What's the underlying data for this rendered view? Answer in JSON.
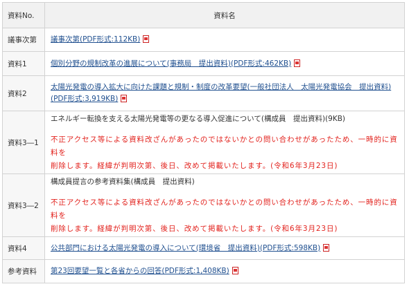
{
  "headers": {
    "no": "資料No.",
    "name": "資料名"
  },
  "rows": [
    {
      "no": "議事次第",
      "link": "議事次第(PDF形式:112KB)"
    },
    {
      "no": "資料1",
      "link": "個別分野の規制改革の進展について(事務局　提出資料)(PDF形式:462KB)"
    },
    {
      "no": "資料2",
      "link": "太陽光発電の導入拡大に向けた課題と規制・制度の改革要望(一般社団法人　太陽光発電協会　提出資料)(PDF形式:3,919KB)"
    },
    {
      "no": "資料3―1",
      "text": "エネルギー転換を支える太陽光発電等の更なる導入促進について(構成員　提出資料)(9KB)",
      "notice_1": "不正アクセス等による資料改ざんがあったのではないかとの問い合わせがあったため、一時的に資料を",
      "notice_2": "削除します。経緯が判明次第、後日、改めて掲載いたします。(令和6年3月23日)"
    },
    {
      "no": "資料3―2",
      "text": "構成員提言の参考資料集(構成員　提出資料)",
      "notice_1": "不正アクセス等による資料改ざんがあったのではないかとの問い合わせがあったため、一時的に資料を",
      "notice_2": "削除します。経緯が判明次第、後日、改めて掲載いたします。(令和6年3月23日)"
    },
    {
      "no": "資料4",
      "link": "公共部門における太陽光発電の導入について(環境省　提出資料)(PDF形式:598KB)"
    },
    {
      "no": "参考資料",
      "link": "第23回要望一覧と各省からの回答(PDF形式:1,408KB)"
    }
  ],
  "icons": {
    "pdf": "pdf-file-icon"
  },
  "colors": {
    "link": "#1f4f8f",
    "notice": "#e2211c",
    "header_bg": "#f1f1f1",
    "border": "#d2d2d2"
  }
}
